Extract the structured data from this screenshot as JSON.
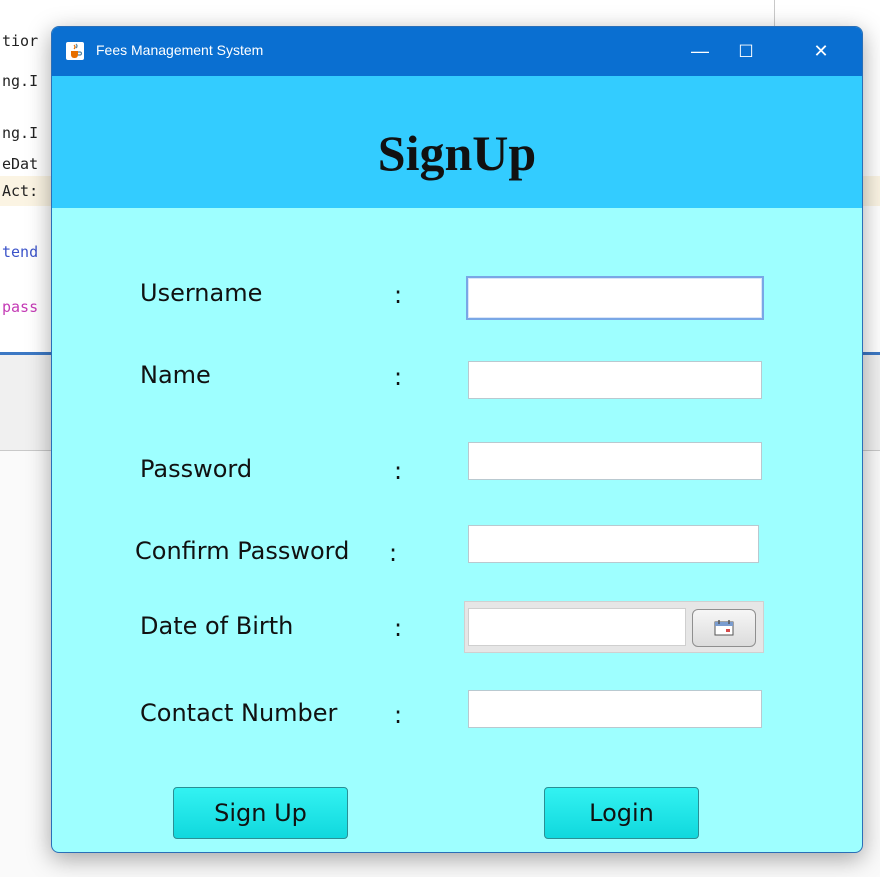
{
  "background": {
    "code_fragments": [
      "tior",
      "ng.I",
      "ng.I",
      "eDat",
      "Act:",
      "tend",
      "pass"
    ]
  },
  "window": {
    "title": "Fees Management System",
    "icon": "java-cup-icon",
    "controls": {
      "minimize": "—",
      "maximize": "☐",
      "close": "✕"
    }
  },
  "form": {
    "heading": "SignUp",
    "separator": ":",
    "fields": [
      {
        "label": "Username",
        "value": ""
      },
      {
        "label": "Name",
        "value": ""
      },
      {
        "label": "Password",
        "value": ""
      },
      {
        "label": "Confirm Password",
        "value": ""
      },
      {
        "label": "Date of Birth",
        "value": ""
      },
      {
        "label": "Contact Number",
        "value": ""
      }
    ],
    "calendar_icon": "calendar-icon"
  },
  "actions": {
    "signup_label": "Sign Up",
    "login_label": "Login"
  },
  "colors": {
    "titlebar": "#0a6fd1",
    "header_band": "#33ccff",
    "form_background": "#9effff",
    "button": "#10d8dd"
  }
}
